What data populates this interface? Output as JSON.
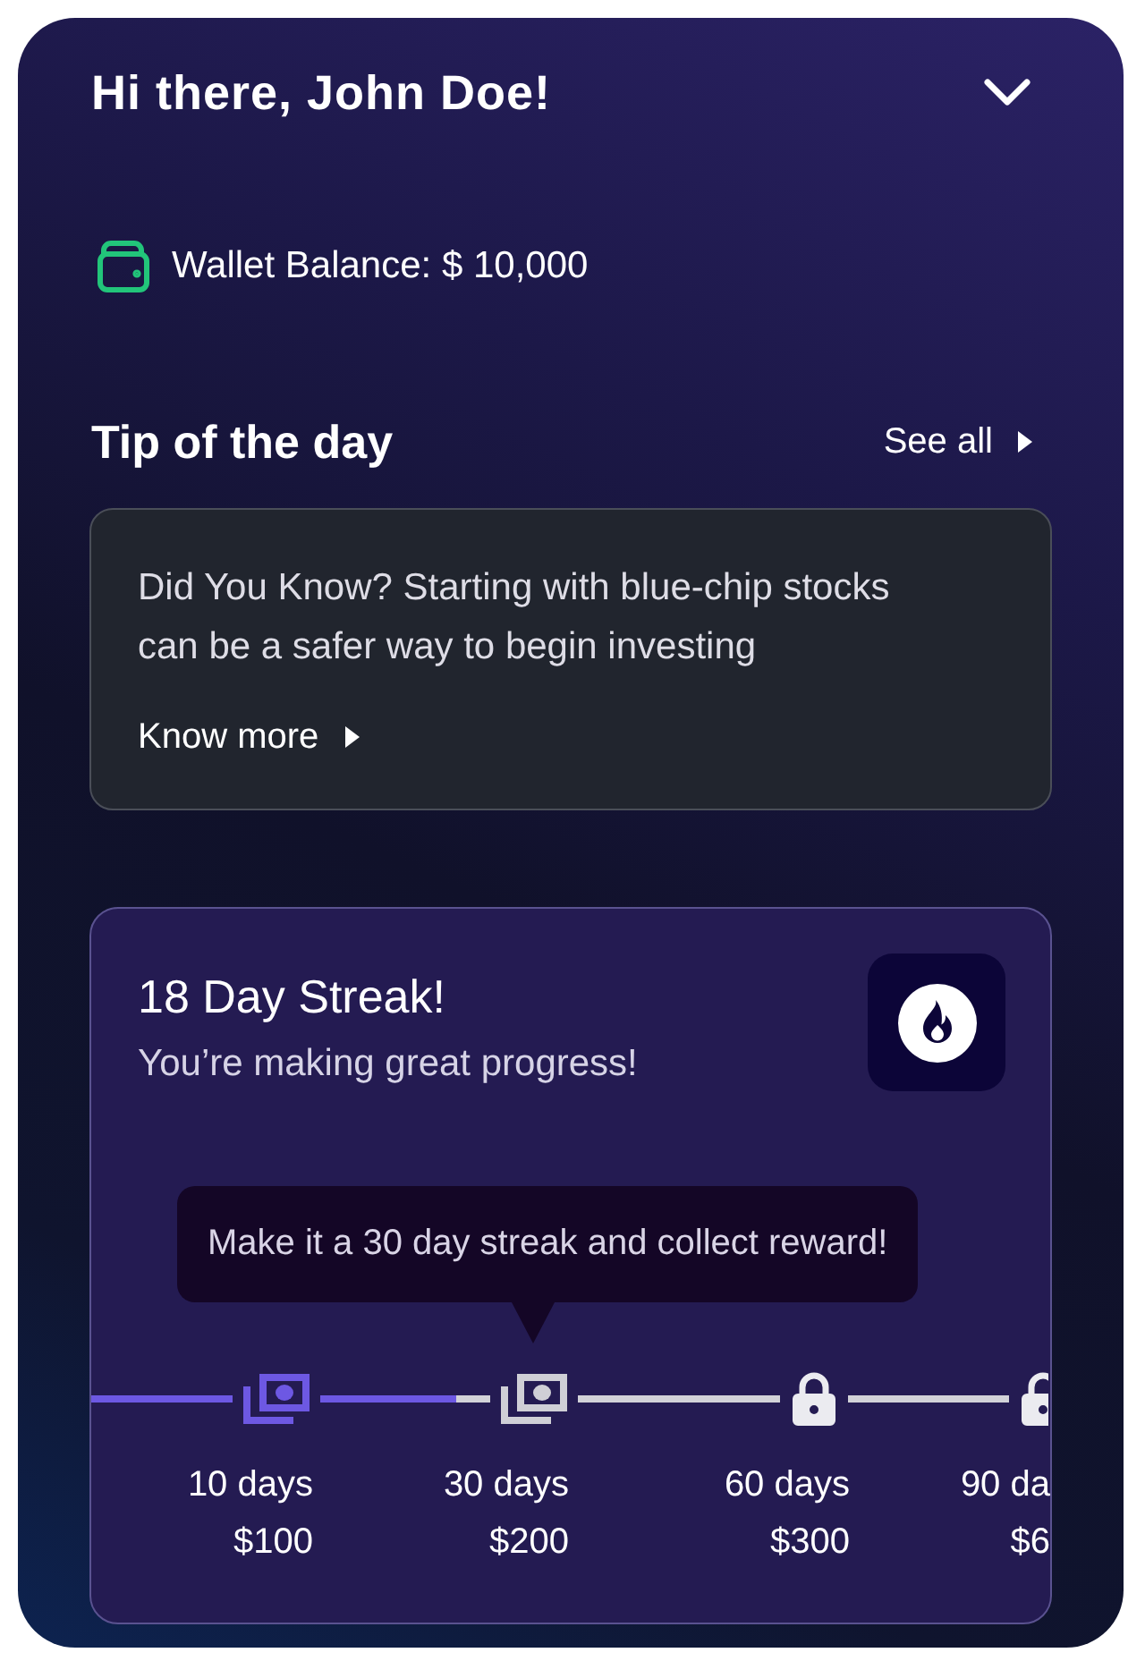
{
  "header": {
    "greeting": "Hi there, John Doe!"
  },
  "wallet": {
    "label": "Wallet Balance: $ 10,000"
  },
  "tip_section": {
    "title": "Tip of the day",
    "see_all": "See all"
  },
  "tip_card": {
    "text": "Did You Know? Starting with blue-chip stocks can be a safer way to begin investing",
    "link": "Know more"
  },
  "streak": {
    "title": "18 Day Streak!",
    "subtitle": "You’re making great progress!",
    "tooltip": "Make it a 30 day streak and collect reward!",
    "milestones": [
      {
        "kind": "cash",
        "reached": true,
        "level": 1,
        "days": "10 days",
        "reward": "$100"
      },
      {
        "kind": "cash",
        "reached": false,
        "level": 0.8,
        "days": "30 days",
        "reward": "$200"
      },
      {
        "kind": "lock",
        "reached": false,
        "level": 0,
        "days": "60 days",
        "reward": "$300"
      },
      {
        "kind": "lock",
        "reached": false,
        "level": 0,
        "days": "90 da",
        "reward": "$6"
      }
    ]
  }
}
